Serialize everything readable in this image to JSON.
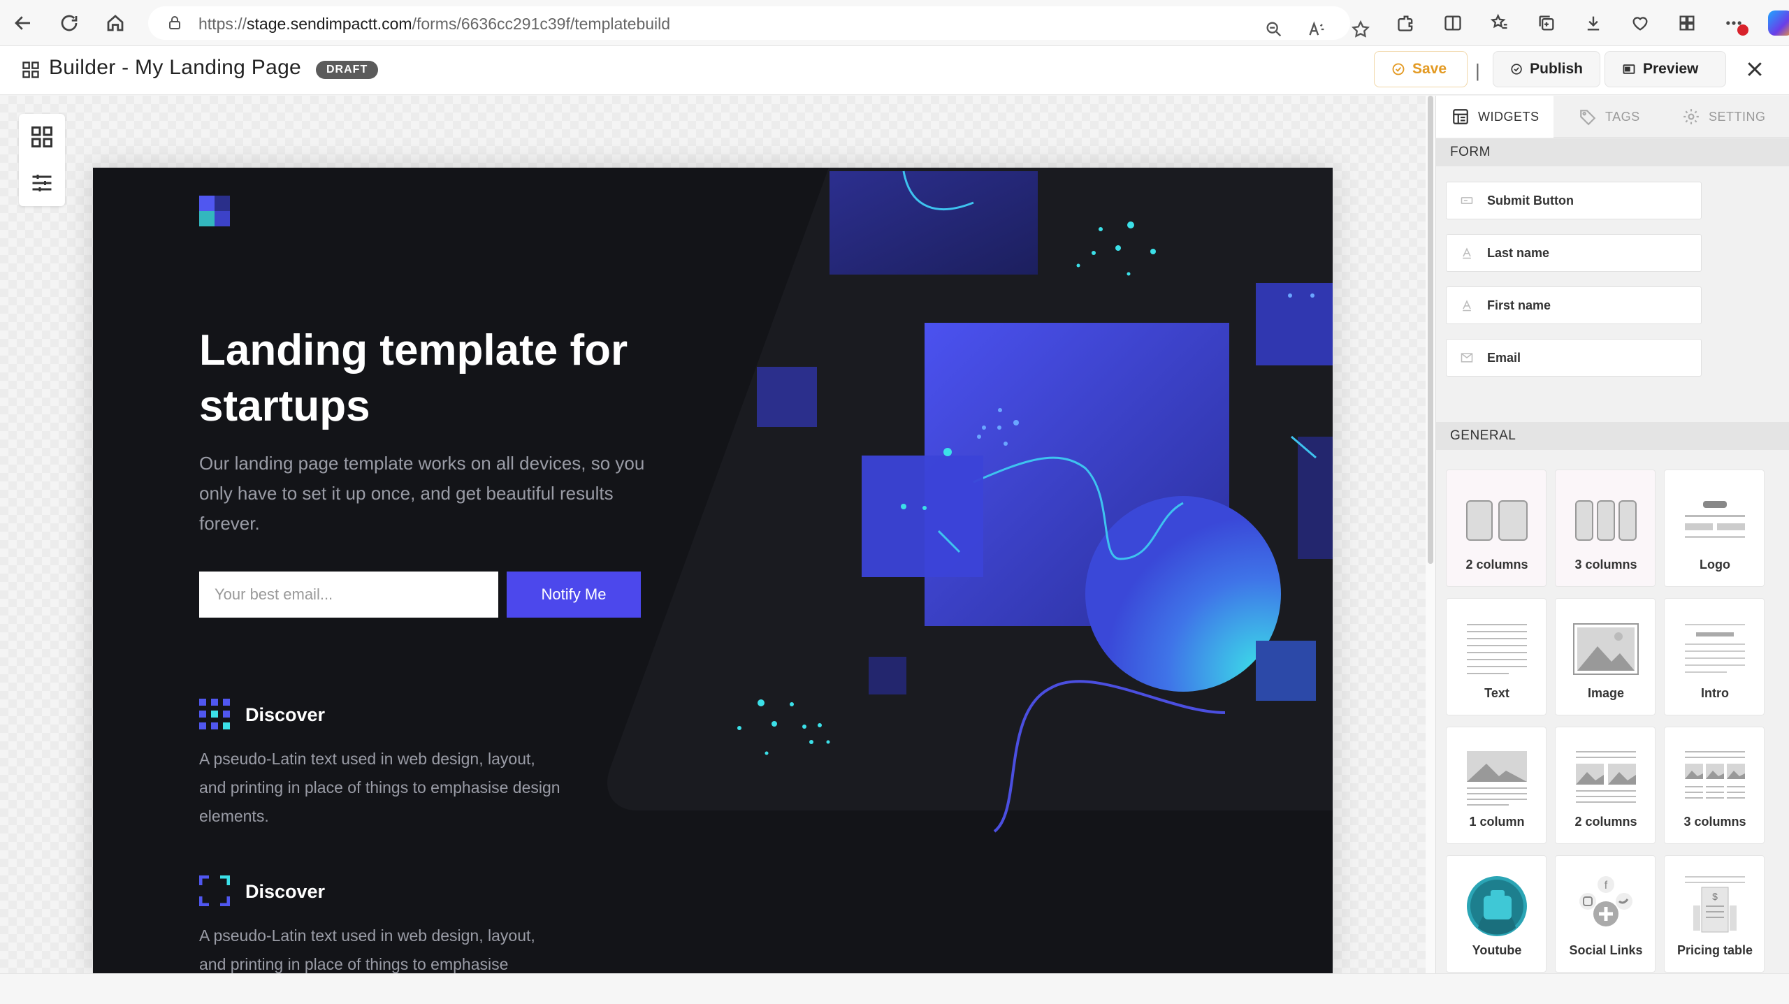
{
  "browser": {
    "url_prefix": "https://",
    "url_host": "stage.sendimpactt.com",
    "url_path": "/forms/6636cc291c39f/templatebuild"
  },
  "header": {
    "title": "Builder - My Landing Page",
    "status_badge": "DRAFT",
    "save_label": "Save",
    "separator": "|",
    "publish_label": "Publish",
    "preview_label": "Preview"
  },
  "landing": {
    "title": "Landing template for startups",
    "subtitle": "Our landing page template works on all devices, so you only have to set it up once, and get beautiful results forever.",
    "email_placeholder": "Your best email...",
    "cta_label": "Notify Me",
    "features": [
      {
        "heading": "Discover",
        "text": "A pseudo-Latin text used in web design, layout, and printing in place of things to emphasise design elements."
      },
      {
        "heading": "Discover",
        "text": "A pseudo-Latin text used in web design, layout, and printing in place of things to emphasise"
      }
    ],
    "colors": {
      "background": "#131418",
      "accent": "#4c48ec",
      "cyan": "#3ce0e8"
    }
  },
  "panel": {
    "tabs": [
      {
        "label": "WIDGETS",
        "icon": "widgets-icon",
        "active": true
      },
      {
        "label": "TAGS",
        "icon": "tag-icon",
        "active": false
      },
      {
        "label": "SETTING",
        "icon": "gear-icon",
        "active": false
      }
    ],
    "form_section": "FORM",
    "form_fields": [
      {
        "label": "Submit Button",
        "icon": "button-icon"
      },
      {
        "label": "Last name",
        "icon": "text-field-icon"
      },
      {
        "label": "First name",
        "icon": "text-field-icon"
      },
      {
        "label": "Email",
        "icon": "envelope-icon"
      }
    ],
    "general_section": "GENERAL",
    "widgets": [
      {
        "label": "2 columns",
        "icon": "two-columns-icon"
      },
      {
        "label": "3 columns",
        "icon": "three-columns-icon"
      },
      {
        "label": "Logo",
        "icon": "logo-block-icon"
      },
      {
        "label": "Text",
        "icon": "text-block-icon"
      },
      {
        "label": "Image",
        "icon": "image-block-icon"
      },
      {
        "label": "Intro",
        "icon": "intro-block-icon"
      },
      {
        "label": "1 column",
        "icon": "one-column-image-icon"
      },
      {
        "label": "2 columns",
        "icon": "two-column-image-icon"
      },
      {
        "label": "3 columns",
        "icon": "three-column-image-icon"
      },
      {
        "label": "Youtube",
        "icon": "youtube-icon"
      },
      {
        "label": "Social Links",
        "icon": "social-links-icon"
      },
      {
        "label": "Pricing table",
        "icon": "pricing-table-icon"
      }
    ]
  }
}
